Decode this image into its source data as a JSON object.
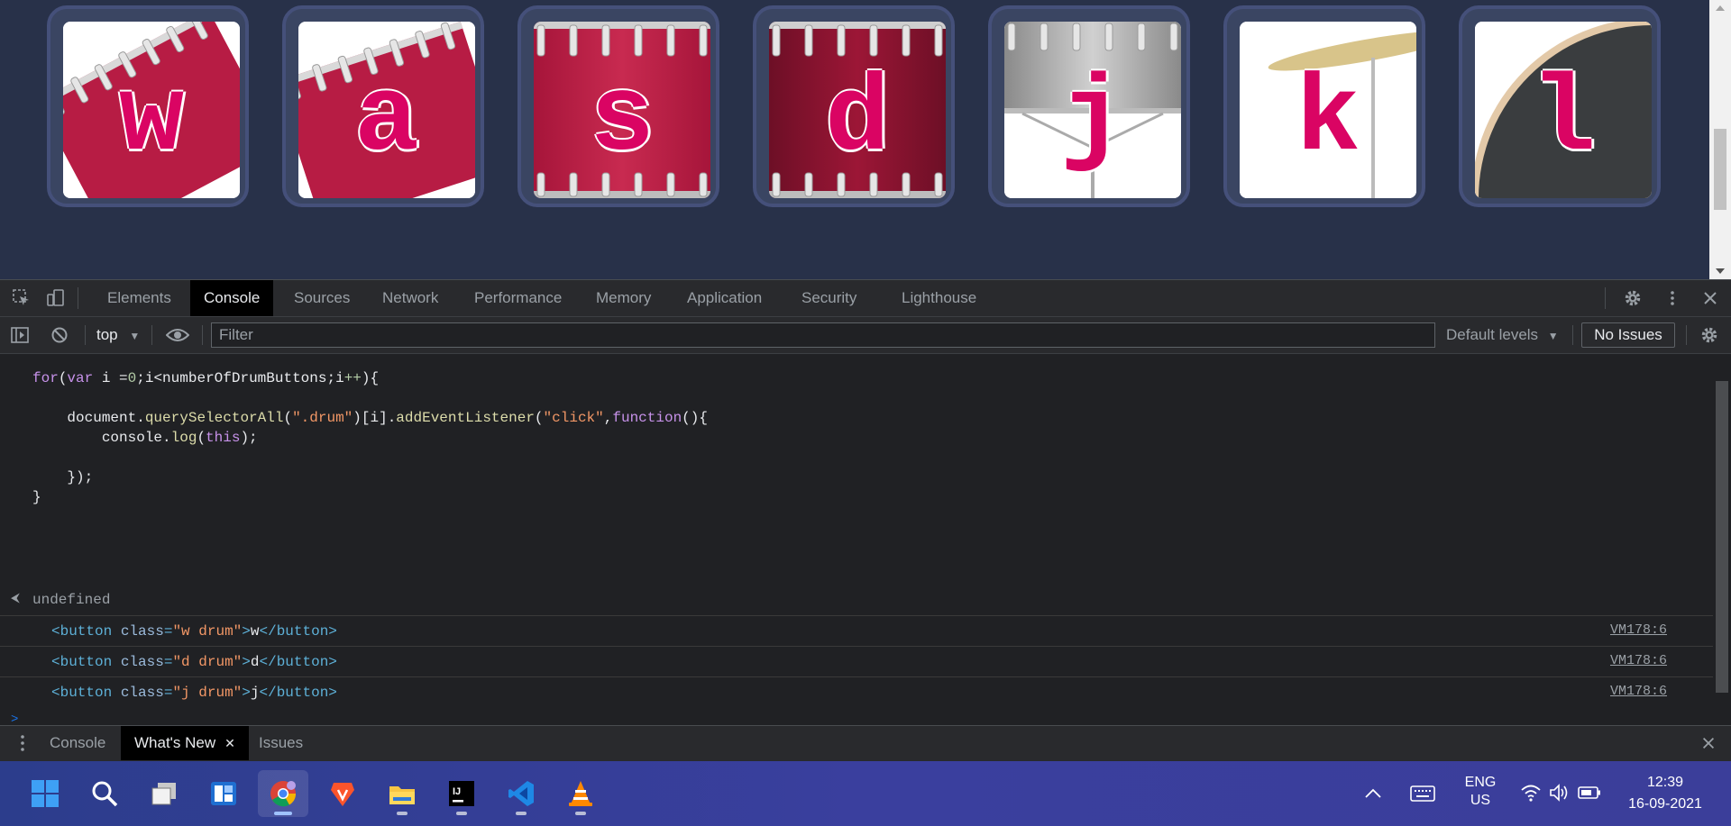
{
  "drums": [
    {
      "letter": "w",
      "image": "crash-tom-red"
    },
    {
      "letter": "a",
      "image": "tom-red-angled"
    },
    {
      "letter": "s",
      "image": "tom-red"
    },
    {
      "letter": "d",
      "image": "tom-dark-red"
    },
    {
      "letter": "j",
      "image": "snare-silver"
    },
    {
      "letter": "k",
      "image": "cymbal"
    },
    {
      "letter": "l",
      "image": "kick-drum"
    }
  ],
  "devtools": {
    "tabs": [
      "Elements",
      "Console",
      "Sources",
      "Network",
      "Performance",
      "Memory",
      "Application",
      "Security",
      "Lighthouse"
    ],
    "active_tab": "Console",
    "context": "top",
    "filter_placeholder": "Filter",
    "levels": "Default levels",
    "issues": "No Issues"
  },
  "console": {
    "code_lines": [
      "for(var i =0;i<numberOfDrumButtons;i++){",
      "",
      "    document.querySelectorAll(\".drum\")[i].addEventListener(\"click\",function(){",
      "        console.log(this);",
      "",
      "    });",
      "}"
    ],
    "result": "undefined",
    "logs": [
      {
        "cls": "w drum",
        "inner": "w",
        "source": "VM178:6"
      },
      {
        "cls": "d drum",
        "inner": "d",
        "source": "VM178:6"
      },
      {
        "cls": "j drum",
        "inner": "j",
        "source": "VM178:6"
      }
    ]
  },
  "drawer": {
    "tabs": [
      "Console",
      "What's New",
      "Issues"
    ],
    "active_tab": "What's New"
  },
  "taskbar": {
    "apps": [
      "start-icon",
      "search-icon",
      "task-view-icon",
      "widgets-icon",
      "chrome-icon",
      "brave-icon",
      "file-explorer-icon",
      "intellij-icon",
      "vscode-icon",
      "vlc-icon"
    ],
    "active_app": "chrome-icon",
    "lang_top": "ENG",
    "lang_bottom": "US",
    "time": "12:39",
    "date": "16-09-2021"
  },
  "colors": {
    "page_bg": "#283149",
    "drum_letter": "#da0463",
    "devtools_bg": "#202124"
  }
}
